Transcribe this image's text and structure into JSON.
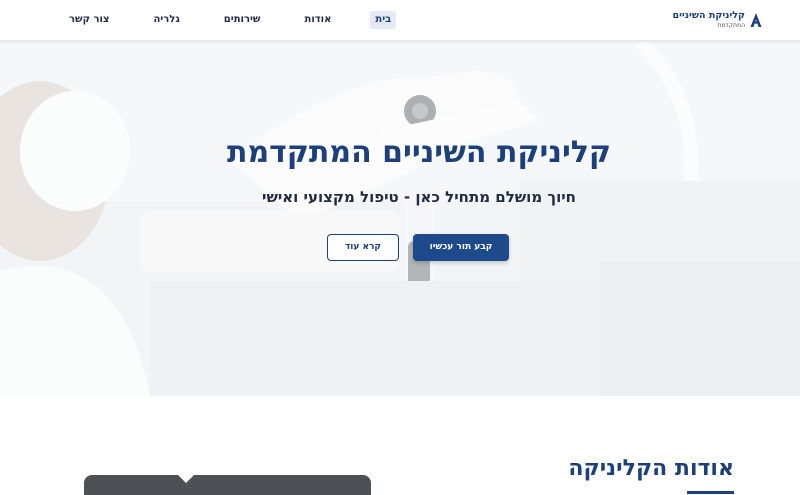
{
  "brand": {
    "name": "קליניקת השיניים",
    "tagline": "המתקדמת",
    "logo_icon": "tooth-a-icon"
  },
  "nav": {
    "items": [
      {
        "label": "צור קשר",
        "active": false
      },
      {
        "label": "גלריה",
        "active": false
      },
      {
        "label": "שירותים",
        "active": false
      },
      {
        "label": "אודות",
        "active": false
      },
      {
        "label": "בית",
        "active": true
      }
    ]
  },
  "hero": {
    "title": "קליניקת השיניים המתקדמת",
    "subtitle": "חיוך מושלם מתחיל כאן - טיפול מקצועי ואישי",
    "primary_button": "קבע תור עכשיו",
    "secondary_button": "קרא עוד"
  },
  "about": {
    "title": "אודות הקליניקה"
  },
  "colors": {
    "accent": "#1d3f7a",
    "button": "#1d4a8a",
    "nav_active_bg": "#e3e9f5"
  }
}
